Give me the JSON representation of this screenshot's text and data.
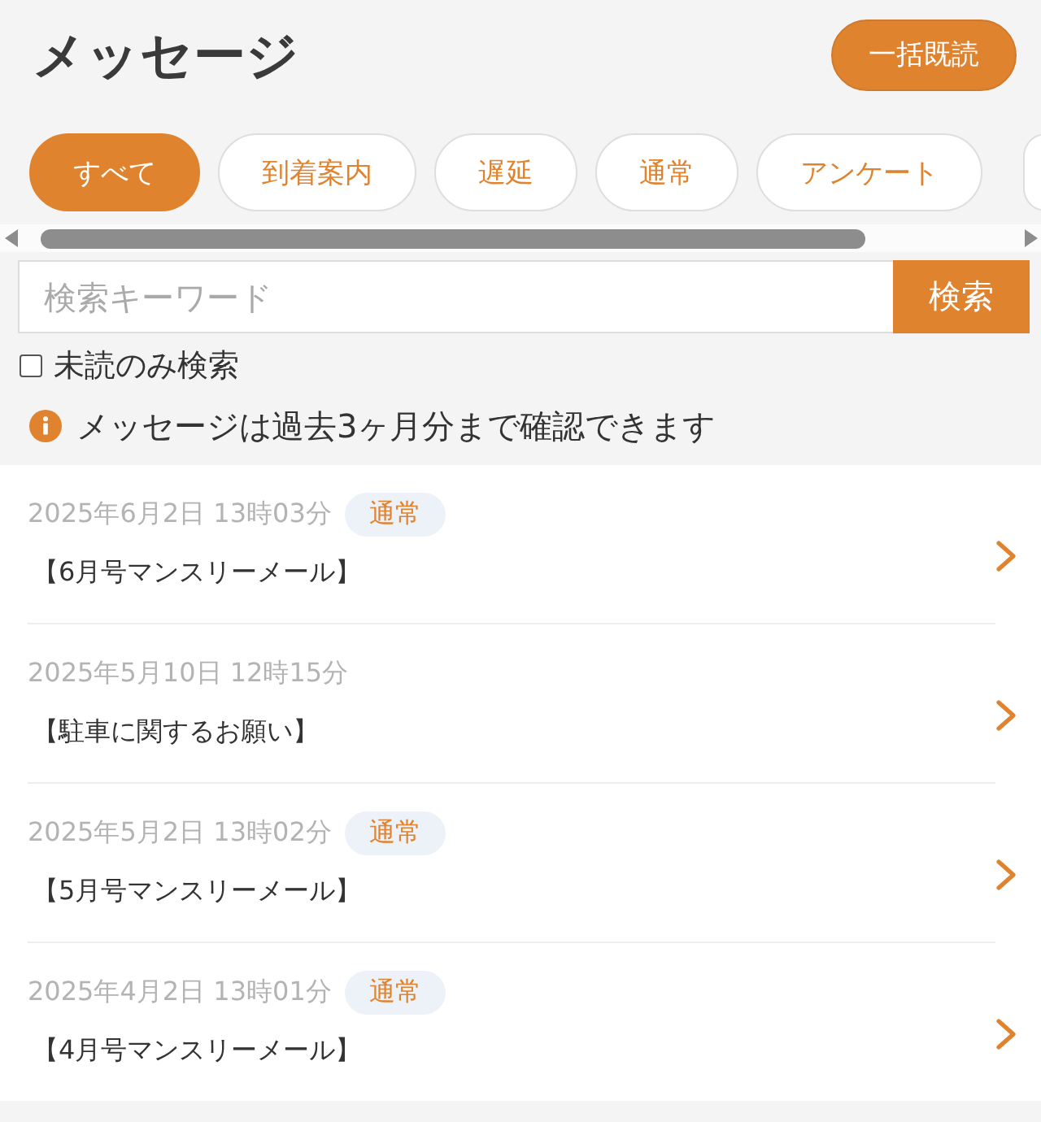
{
  "header": {
    "title": "メッセージ",
    "mark_all_read_button": "一括既読"
  },
  "filter_tabs": [
    {
      "label": "すべて",
      "selected": true
    },
    {
      "label": "到着案内",
      "selected": false
    },
    {
      "label": "遅延",
      "selected": false
    },
    {
      "label": "通常",
      "selected": false
    },
    {
      "label": "アンケート",
      "selected": false
    }
  ],
  "search": {
    "placeholder": "検索キーワード",
    "button": "検索",
    "unread_only": {
      "label": "未読のみ検索",
      "checked": false
    }
  },
  "notice": "メッセージは過去3ヶ月分まで確認できます",
  "messages": [
    {
      "date": "2025年6月2日 13時03分",
      "category": "通常",
      "title": "【6月号マンスリーメール】"
    },
    {
      "date": "2025年5月10日 12時15分",
      "title": "【駐車に関するお願い】"
    },
    {
      "date": "2025年5月2日 13時02分",
      "category": "通常",
      "title": "【5月号マンスリーメール】"
    },
    {
      "date": "2025年4月2日 13時01分",
      "category": "通常",
      "title": "【4月号マンスリーメール】"
    }
  ]
}
